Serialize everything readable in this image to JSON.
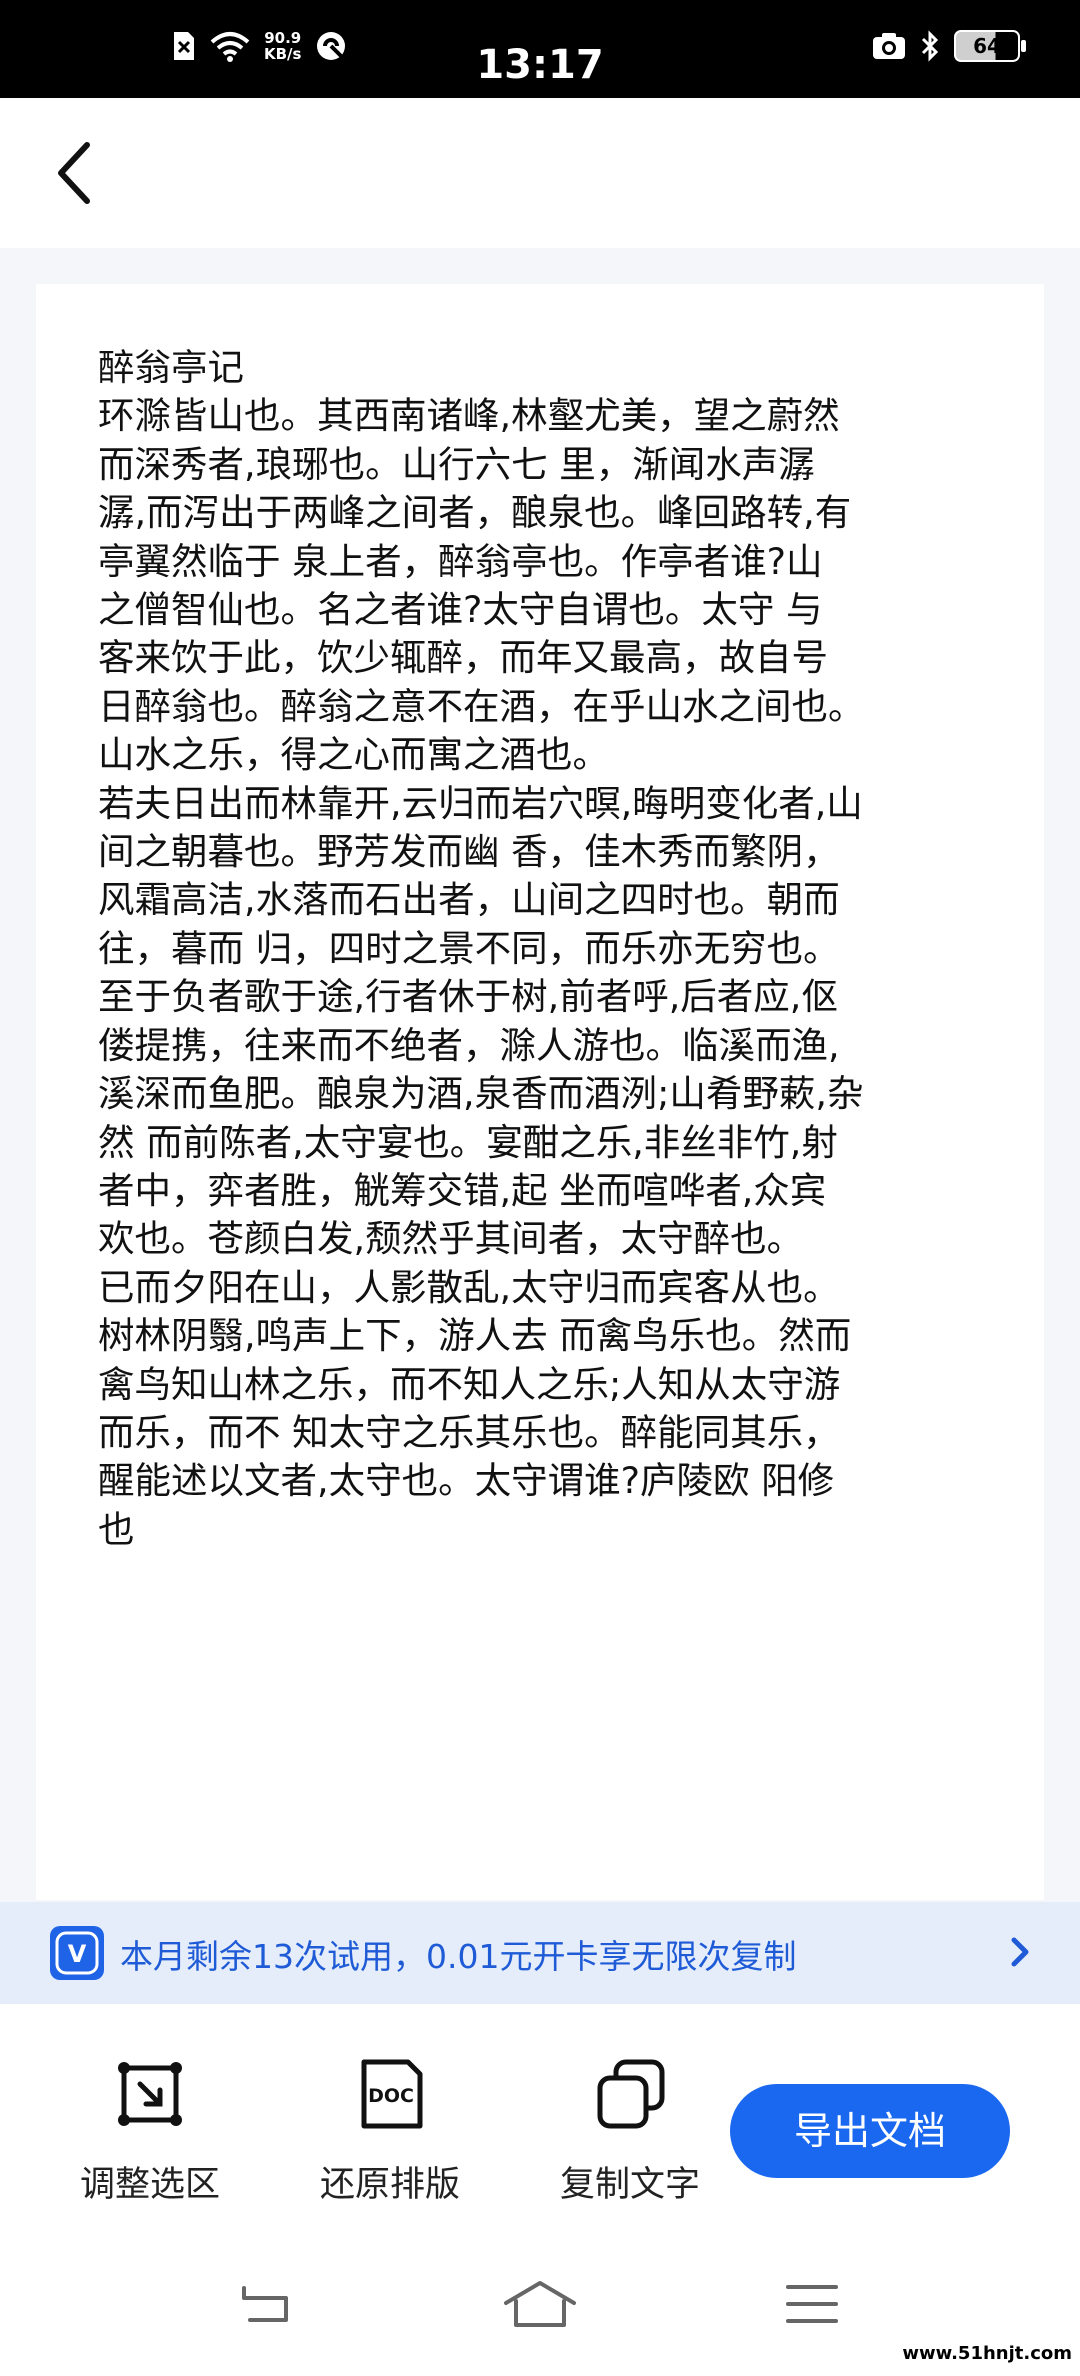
{
  "status_bar": {
    "time": "13:17",
    "net_speed_value": "90.9",
    "net_speed_unit": "KB/s",
    "battery": "64"
  },
  "document": {
    "lines": [
      "醉翁亭记",
      "环滁皆山也。其西南诸峰,林壑尤美，望之蔚然",
      "而深秀者,琅琊也。山行六七 里，渐闻水声潺",
      "潺,而泻出于两峰之间者，酿泉也。峰回路转,有",
      "亭翼然临于 泉上者，醉翁亭也。作亭者谁?山",
      "之僧智仙也。名之者谁?太守自谓也。太守 与",
      "客来饮于此，饮少辄醉，而年又最高，故自号",
      "日醉翁也。醉翁之意不在酒，在乎山水之间也。",
      "山水之乐，得之心而寓之酒也。",
      "若夫日出而林靠开,云归而岩穴暝,晦明变化者,山",
      "间之朝暮也。野芳发而幽 香，佳木秀而繁阴，",
      "风霜高洁,水落而石出者，山间之四时也。朝而",
      "往，暮而 归，四时之景不同，而乐亦无穷也。",
      "至于负者歌于途,行者休于树,前者呼,后者应,伛",
      "偻提携，往来而不绝者，滁人游也。临溪而渔,",
      "溪深而鱼肥。酿泉为酒,泉香而酒洌;山肴野蔌,杂",
      "然 而前陈者,太守宴也。宴酣之乐,非丝非竹,射",
      "者中，弈者胜，觥筹交错,起 坐而喧哗者,众宾",
      "欢也。苍颜白发,颓然乎其间者，太守醉也。",
      "已而夕阳在山，人影散乱,太守归而宾客从也。",
      "树林阴翳,鸣声上下，游人去 而禽鸟乐也。然而",
      "禽鸟知山林之乐，而不知人之乐;人知从太守游",
      "而乐，而不 知太守之乐其乐也。醉能同其乐，",
      "醒能述以文者,太守也。太守谓谁?庐陵欧 阳修",
      "也"
    ]
  },
  "promo": {
    "icon_letter": "V",
    "text": "本月剩余13次试用，0.01元开卡享无限次复制"
  },
  "toolbar": {
    "adjust_label": "调整选区",
    "restore_label": "还原排版",
    "restore_icon_text": "DOC",
    "copy_label": "复制文字",
    "export_label": "导出文档"
  },
  "watermark": "www.51hnjt.com",
  "colors": {
    "accent": "#1a68f0",
    "promo_bg": "#e5edfa",
    "promo_text": "#1f5bd6",
    "page_bg": "#f4f6f9"
  }
}
